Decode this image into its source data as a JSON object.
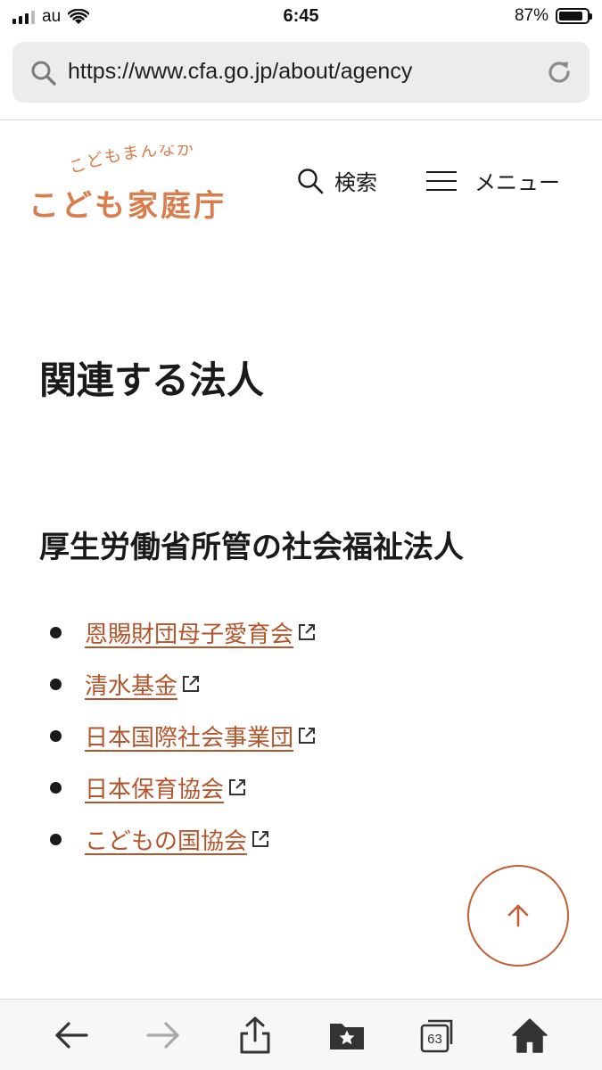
{
  "status_bar": {
    "carrier": "au",
    "time": "6:45",
    "battery": "87%",
    "battery_level": 0.87
  },
  "browser": {
    "url": "https://www.cfa.go.jp/about/agency",
    "tabs_count": "63"
  },
  "header": {
    "logo_tagline": "こどもまんなか",
    "logo_name": "こども家庭庁",
    "search_label": "検索",
    "menu_label": "メニュー"
  },
  "content": {
    "page_title": "関連する法人",
    "section_title": "厚生労働省所管の社会福祉法人",
    "links": [
      {
        "label": "恩賜財団母子愛育会"
      },
      {
        "label": "清水基金"
      },
      {
        "label": "日本国際社会事業団"
      },
      {
        "label": "日本保育協会"
      },
      {
        "label": "こどもの国協会"
      }
    ]
  },
  "colors": {
    "brand_orange": "#d87d4b",
    "link": "#b4542a",
    "accent_circle": "#c25e35"
  },
  "icons": {
    "signal": "cellular-signal-icon",
    "wifi": "wifi-icon",
    "battery": "battery-icon",
    "search": "search-icon",
    "reload": "reload-icon",
    "menu": "hamburger-menu-icon",
    "external": "external-link-icon",
    "to_top": "arrow-up-icon",
    "back": "arrow-left-icon",
    "forward": "arrow-right-icon",
    "share": "share-icon",
    "bookmarks": "bookmarks-icon",
    "tabs": "tabs-icon",
    "home": "home-icon"
  }
}
